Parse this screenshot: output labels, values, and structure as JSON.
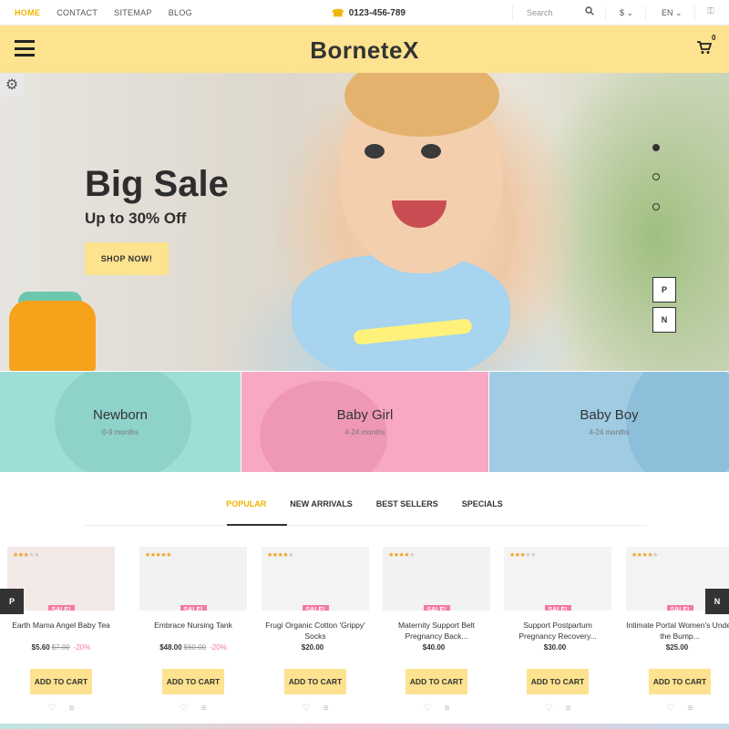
{
  "topbar": {
    "nav": [
      "HOME",
      "CONTACT",
      "SITEMAP",
      "BLOG"
    ],
    "phone": "0123-456-789",
    "search_placeholder": "Search",
    "currency": "$",
    "language": "EN"
  },
  "header": {
    "logo": "BorneteX",
    "cart_count": "0"
  },
  "hero": {
    "title": "Big Sale",
    "subtitle": "Up to 30% Off",
    "button": "SHOP NOW!",
    "prev": "P",
    "next": "N"
  },
  "categories": [
    {
      "name": "Newborn",
      "range": "0-9 months",
      "color": "#9fded6"
    },
    {
      "name": "Baby Girl",
      "range": "4-24 months",
      "color": "#f8a8c2"
    },
    {
      "name": "Baby Boy",
      "range": "4-24 months",
      "color": "#9fcbe3"
    }
  ],
  "tabs": [
    "POPULAR",
    "NEW ARRIVALS",
    "BEST SELLERS",
    "SPECIALS"
  ],
  "products": [
    {
      "name": "Earth Mama Angel Baby Tea",
      "price": "$5.60",
      "old": "$7.00",
      "discount": "-20%",
      "rating": 3,
      "sale": "SALE!",
      "button": "ADD TO CART"
    },
    {
      "name": "Embrace Nursing Tank",
      "price": "$48.00",
      "old": "$60.00",
      "discount": "-20%",
      "rating": 5,
      "sale": "SALE!",
      "button": "ADD TO CART"
    },
    {
      "name": "Frugi Organic Cotton 'Grippy' Socks",
      "price": "$20.00",
      "old": "",
      "discount": "",
      "rating": 4,
      "sale": "SALE!",
      "button": "ADD TO CART"
    },
    {
      "name": "Maternity Support Belt Pregnancy Back...",
      "price": "$40.00",
      "old": "",
      "discount": "",
      "rating": 4,
      "sale": "SALE!",
      "button": "ADD TO CART"
    },
    {
      "name": "Support Postpartum Pregnancy Recovery...",
      "price": "$30.00",
      "old": "",
      "discount": "",
      "rating": 3,
      "sale": "SALE!",
      "button": "ADD TO CART"
    },
    {
      "name": "Intimate Portal Women's Under the Bump...",
      "price": "$25.00",
      "old": "",
      "discount": "",
      "rating": 4,
      "sale": "SALE!",
      "button": "ADD TO CART"
    }
  ],
  "carousel": {
    "prev": "P",
    "next": "N"
  },
  "icons": {
    "phone": "phone-icon",
    "search": "search-icon",
    "cart": "cart-icon",
    "settings": "gears-icon",
    "wishlist": "heart-icon",
    "compare": "compare-icon"
  }
}
